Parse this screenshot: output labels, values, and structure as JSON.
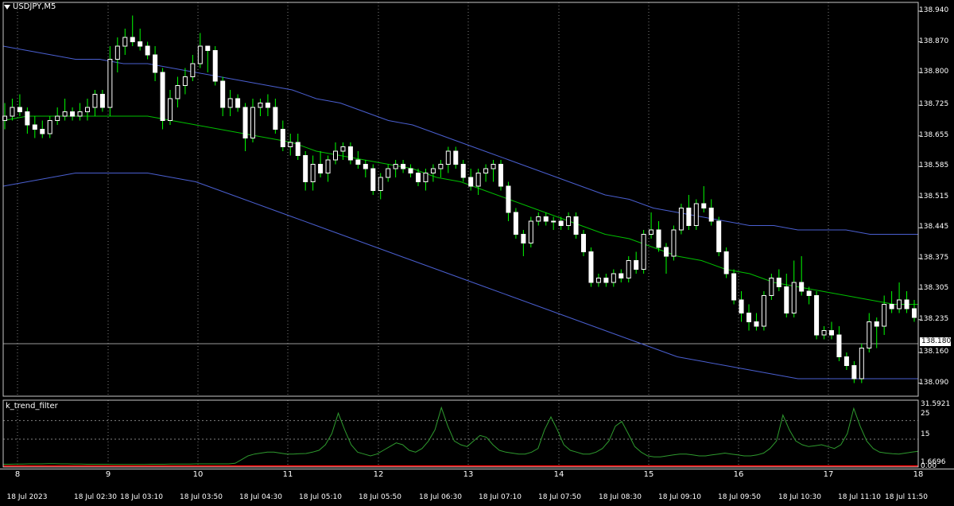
{
  "window": {
    "symbol_title": "USDJPY,M5",
    "indicator_title": "k_trend_filter",
    "current_price": "138.180"
  },
  "colors": {
    "background": "#000000",
    "grid": "#808080",
    "candle_up": "#ffffff",
    "candle_down": "#ffffff",
    "wick": "#00ff00",
    "ma_line": "#00c000",
    "band_line": "#4a5fd0",
    "indicator_line": "#2e9a2e",
    "indicator_zero": "#ff0000"
  },
  "price_axis": {
    "labels": [
      "138.940",
      "138.870",
      "138.800",
      "138.725",
      "138.655",
      "138.585",
      "138.515",
      "138.445",
      "138.375",
      "138.305",
      "138.235",
      "138.160",
      "138.090"
    ]
  },
  "sub_axis": {
    "labels": [
      "31.5921",
      "25",
      "15",
      "1.6696",
      "0.00"
    ]
  },
  "day_labels": [
    "8",
    "9",
    "10",
    "11",
    "12",
    "13",
    "14",
    "15",
    "16",
    "17",
    "18"
  ],
  "time_labels": [
    "18 Jul 2023",
    "18 Jul 02:30",
    "18 Jul 03:10",
    "18 Jul 03:50",
    "18 Jul 04:30",
    "18 Jul 05:10",
    "18 Jul 05:50",
    "18 Jul 06:30",
    "18 Jul 07:10",
    "18 Jul 07:50",
    "18 Jul 08:30",
    "18 Jul 09:10",
    "18 Jul 09:50",
    "18 Jul 10:30",
    "18 Jul 11:10",
    "18 Jul 11:50"
  ],
  "chart_data": {
    "type": "candlestick",
    "symbol": "USDJPY",
    "timeframe": "M5",
    "ylim": [
      138.06,
      138.96
    ],
    "candles": [
      {
        "o": 138.69,
        "h": 138.73,
        "l": 138.67,
        "c": 138.7
      },
      {
        "o": 138.7,
        "h": 138.74,
        "l": 138.69,
        "c": 138.72
      },
      {
        "o": 138.72,
        "h": 138.75,
        "l": 138.7,
        "c": 138.71
      },
      {
        "o": 138.71,
        "h": 138.72,
        "l": 138.66,
        "c": 138.68
      },
      {
        "o": 138.68,
        "h": 138.7,
        "l": 138.65,
        "c": 138.67
      },
      {
        "o": 138.67,
        "h": 138.69,
        "l": 138.65,
        "c": 138.66
      },
      {
        "o": 138.66,
        "h": 138.7,
        "l": 138.65,
        "c": 138.69
      },
      {
        "o": 138.69,
        "h": 138.72,
        "l": 138.68,
        "c": 138.7
      },
      {
        "o": 138.7,
        "h": 138.74,
        "l": 138.69,
        "c": 138.71
      },
      {
        "o": 138.71,
        "h": 138.72,
        "l": 138.69,
        "c": 138.7
      },
      {
        "o": 138.7,
        "h": 138.73,
        "l": 138.69,
        "c": 138.71
      },
      {
        "o": 138.71,
        "h": 138.74,
        "l": 138.69,
        "c": 138.72
      },
      {
        "o": 138.72,
        "h": 138.76,
        "l": 138.7,
        "c": 138.75
      },
      {
        "o": 138.75,
        "h": 138.76,
        "l": 138.71,
        "c": 138.72
      },
      {
        "o": 138.72,
        "h": 138.86,
        "l": 138.7,
        "c": 138.83
      },
      {
        "o": 138.83,
        "h": 138.88,
        "l": 138.8,
        "c": 138.86
      },
      {
        "o": 138.86,
        "h": 138.9,
        "l": 138.84,
        "c": 138.88
      },
      {
        "o": 138.88,
        "h": 138.93,
        "l": 138.86,
        "c": 138.87
      },
      {
        "o": 138.87,
        "h": 138.9,
        "l": 138.85,
        "c": 138.86
      },
      {
        "o": 138.86,
        "h": 138.87,
        "l": 138.83,
        "c": 138.84
      },
      {
        "o": 138.84,
        "h": 138.86,
        "l": 138.78,
        "c": 138.8
      },
      {
        "o": 138.8,
        "h": 138.81,
        "l": 138.67,
        "c": 138.69
      },
      {
        "o": 138.69,
        "h": 138.76,
        "l": 138.68,
        "c": 138.74
      },
      {
        "o": 138.74,
        "h": 138.79,
        "l": 138.72,
        "c": 138.77
      },
      {
        "o": 138.77,
        "h": 138.81,
        "l": 138.75,
        "c": 138.79
      },
      {
        "o": 138.79,
        "h": 138.84,
        "l": 138.78,
        "c": 138.82
      },
      {
        "o": 138.82,
        "h": 138.89,
        "l": 138.81,
        "c": 138.86
      },
      {
        "o": 138.86,
        "h": 138.86,
        "l": 138.8,
        "c": 138.85
      },
      {
        "o": 138.85,
        "h": 138.86,
        "l": 138.77,
        "c": 138.78
      },
      {
        "o": 138.78,
        "h": 138.79,
        "l": 138.7,
        "c": 138.72
      },
      {
        "o": 138.72,
        "h": 138.76,
        "l": 138.7,
        "c": 138.74
      },
      {
        "o": 138.74,
        "h": 138.75,
        "l": 138.71,
        "c": 138.72
      },
      {
        "o": 138.72,
        "h": 138.73,
        "l": 138.62,
        "c": 138.65
      },
      {
        "o": 138.65,
        "h": 138.74,
        "l": 138.64,
        "c": 138.72
      },
      {
        "o": 138.72,
        "h": 138.74,
        "l": 138.7,
        "c": 138.73
      },
      {
        "o": 138.73,
        "h": 138.75,
        "l": 138.7,
        "c": 138.72
      },
      {
        "o": 138.72,
        "h": 138.74,
        "l": 138.66,
        "c": 138.67
      },
      {
        "o": 138.67,
        "h": 138.69,
        "l": 138.62,
        "c": 138.63
      },
      {
        "o": 138.63,
        "h": 138.66,
        "l": 138.61,
        "c": 138.64
      },
      {
        "o": 138.64,
        "h": 138.66,
        "l": 138.6,
        "c": 138.61
      },
      {
        "o": 138.61,
        "h": 138.62,
        "l": 138.53,
        "c": 138.55
      },
      {
        "o": 138.55,
        "h": 138.61,
        "l": 138.53,
        "c": 138.59
      },
      {
        "o": 138.59,
        "h": 138.62,
        "l": 138.56,
        "c": 138.57
      },
      {
        "o": 138.57,
        "h": 138.61,
        "l": 138.55,
        "c": 138.6
      },
      {
        "o": 138.6,
        "h": 138.64,
        "l": 138.59,
        "c": 138.62
      },
      {
        "o": 138.62,
        "h": 138.64,
        "l": 138.6,
        "c": 138.63
      },
      {
        "o": 138.63,
        "h": 138.64,
        "l": 138.59,
        "c": 138.6
      },
      {
        "o": 138.6,
        "h": 138.62,
        "l": 138.58,
        "c": 138.59
      },
      {
        "o": 138.59,
        "h": 138.6,
        "l": 138.56,
        "c": 138.58
      },
      {
        "o": 138.58,
        "h": 138.59,
        "l": 138.52,
        "c": 138.53
      },
      {
        "o": 138.53,
        "h": 138.57,
        "l": 138.51,
        "c": 138.56
      },
      {
        "o": 138.56,
        "h": 138.59,
        "l": 138.55,
        "c": 138.58
      },
      {
        "o": 138.58,
        "h": 138.6,
        "l": 138.56,
        "c": 138.59
      },
      {
        "o": 138.59,
        "h": 138.6,
        "l": 138.57,
        "c": 138.58
      },
      {
        "o": 138.58,
        "h": 138.59,
        "l": 138.56,
        "c": 138.57
      },
      {
        "o": 138.57,
        "h": 138.58,
        "l": 138.54,
        "c": 138.55
      },
      {
        "o": 138.55,
        "h": 138.58,
        "l": 138.53,
        "c": 138.57
      },
      {
        "o": 138.57,
        "h": 138.59,
        "l": 138.55,
        "c": 138.58
      },
      {
        "o": 138.58,
        "h": 138.6,
        "l": 138.56,
        "c": 138.59
      },
      {
        "o": 138.59,
        "h": 138.63,
        "l": 138.57,
        "c": 138.62
      },
      {
        "o": 138.62,
        "h": 138.63,
        "l": 138.58,
        "c": 138.59
      },
      {
        "o": 138.59,
        "h": 138.6,
        "l": 138.55,
        "c": 138.56
      },
      {
        "o": 138.56,
        "h": 138.58,
        "l": 138.53,
        "c": 138.54
      },
      {
        "o": 138.54,
        "h": 138.58,
        "l": 138.52,
        "c": 138.57
      },
      {
        "o": 138.57,
        "h": 138.59,
        "l": 138.55,
        "c": 138.58
      },
      {
        "o": 138.58,
        "h": 138.6,
        "l": 138.55,
        "c": 138.59
      },
      {
        "o": 138.59,
        "h": 138.6,
        "l": 138.53,
        "c": 138.54
      },
      {
        "o": 138.54,
        "h": 138.55,
        "l": 138.46,
        "c": 138.48
      },
      {
        "o": 138.48,
        "h": 138.49,
        "l": 138.42,
        "c": 138.43
      },
      {
        "o": 138.43,
        "h": 138.44,
        "l": 138.38,
        "c": 138.41
      },
      {
        "o": 138.41,
        "h": 138.47,
        "l": 138.4,
        "c": 138.46
      },
      {
        "o": 138.46,
        "h": 138.48,
        "l": 138.45,
        "c": 138.47
      },
      {
        "o": 138.47,
        "h": 138.48,
        "l": 138.45,
        "c": 138.46
      },
      {
        "o": 138.46,
        "h": 138.47,
        "l": 138.44,
        "c": 138.46
      },
      {
        "o": 138.46,
        "h": 138.47,
        "l": 138.44,
        "c": 138.45
      },
      {
        "o": 138.45,
        "h": 138.48,
        "l": 138.44,
        "c": 138.47
      },
      {
        "o": 138.47,
        "h": 138.48,
        "l": 138.42,
        "c": 138.43
      },
      {
        "o": 138.43,
        "h": 138.44,
        "l": 138.38,
        "c": 138.39
      },
      {
        "o": 138.39,
        "h": 138.4,
        "l": 138.31,
        "c": 138.32
      },
      {
        "o": 138.32,
        "h": 138.34,
        "l": 138.31,
        "c": 138.33
      },
      {
        "o": 138.33,
        "h": 138.34,
        "l": 138.31,
        "c": 138.32
      },
      {
        "o": 138.32,
        "h": 138.35,
        "l": 138.31,
        "c": 138.34
      },
      {
        "o": 138.34,
        "h": 138.35,
        "l": 138.32,
        "c": 138.33
      },
      {
        "o": 138.33,
        "h": 138.38,
        "l": 138.32,
        "c": 138.37
      },
      {
        "o": 138.37,
        "h": 138.39,
        "l": 138.34,
        "c": 138.35
      },
      {
        "o": 138.35,
        "h": 138.44,
        "l": 138.34,
        "c": 138.43
      },
      {
        "o": 138.43,
        "h": 138.48,
        "l": 138.42,
        "c": 138.44
      },
      {
        "o": 138.44,
        "h": 138.46,
        "l": 138.39,
        "c": 138.4
      },
      {
        "o": 138.4,
        "h": 138.41,
        "l": 138.34,
        "c": 138.38
      },
      {
        "o": 138.38,
        "h": 138.45,
        "l": 138.37,
        "c": 138.44
      },
      {
        "o": 138.44,
        "h": 138.5,
        "l": 138.43,
        "c": 138.49
      },
      {
        "o": 138.49,
        "h": 138.52,
        "l": 138.44,
        "c": 138.45
      },
      {
        "o": 138.45,
        "h": 138.51,
        "l": 138.44,
        "c": 138.5
      },
      {
        "o": 138.5,
        "h": 138.54,
        "l": 138.48,
        "c": 138.49
      },
      {
        "o": 138.49,
        "h": 138.51,
        "l": 138.45,
        "c": 138.46
      },
      {
        "o": 138.46,
        "h": 138.47,
        "l": 138.38,
        "c": 138.39
      },
      {
        "o": 138.39,
        "h": 138.4,
        "l": 138.33,
        "c": 138.34
      },
      {
        "o": 138.34,
        "h": 138.35,
        "l": 138.27,
        "c": 138.28
      },
      {
        "o": 138.28,
        "h": 138.3,
        "l": 138.23,
        "c": 138.25
      },
      {
        "o": 138.25,
        "h": 138.27,
        "l": 138.21,
        "c": 138.23
      },
      {
        "o": 138.23,
        "h": 138.25,
        "l": 138.21,
        "c": 138.22
      },
      {
        "o": 138.22,
        "h": 138.3,
        "l": 138.21,
        "c": 138.29
      },
      {
        "o": 138.29,
        "h": 138.34,
        "l": 138.28,
        "c": 138.33
      },
      {
        "o": 138.33,
        "h": 138.35,
        "l": 138.3,
        "c": 138.31
      },
      {
        "o": 138.31,
        "h": 138.34,
        "l": 138.24,
        "c": 138.25
      },
      {
        "o": 138.25,
        "h": 138.37,
        "l": 138.24,
        "c": 138.32
      },
      {
        "o": 138.32,
        "h": 138.38,
        "l": 138.29,
        "c": 138.3
      },
      {
        "o": 138.3,
        "h": 138.31,
        "l": 138.27,
        "c": 138.29
      },
      {
        "o": 138.29,
        "h": 138.3,
        "l": 138.19,
        "c": 138.2
      },
      {
        "o": 138.2,
        "h": 138.22,
        "l": 138.19,
        "c": 138.21
      },
      {
        "o": 138.21,
        "h": 138.23,
        "l": 138.19,
        "c": 138.2
      },
      {
        "o": 138.2,
        "h": 138.22,
        "l": 138.14,
        "c": 138.15
      },
      {
        "o": 138.15,
        "h": 138.16,
        "l": 138.12,
        "c": 138.13
      },
      {
        "o": 138.13,
        "h": 138.14,
        "l": 138.09,
        "c": 138.1
      },
      {
        "o": 138.1,
        "h": 138.18,
        "l": 138.09,
        "c": 138.17
      },
      {
        "o": 138.17,
        "h": 138.25,
        "l": 138.16,
        "c": 138.23
      },
      {
        "o": 138.23,
        "h": 138.24,
        "l": 138.17,
        "c": 138.22
      },
      {
        "o": 138.22,
        "h": 138.29,
        "l": 138.2,
        "c": 138.27
      },
      {
        "o": 138.27,
        "h": 138.3,
        "l": 138.25,
        "c": 138.26
      },
      {
        "o": 138.26,
        "h": 138.32,
        "l": 138.25,
        "c": 138.28
      },
      {
        "o": 138.28,
        "h": 138.3,
        "l": 138.25,
        "c": 138.26
      },
      {
        "o": 138.26,
        "h": 138.28,
        "l": 138.23,
        "c": 138.24
      }
    ],
    "ma": [
      138.69,
      138.7,
      138.7,
      138.7,
      138.7,
      138.7,
      138.7,
      138.69,
      138.68,
      138.67,
      138.66,
      138.65,
      138.64,
      138.62,
      138.61,
      138.6,
      138.59,
      138.58,
      138.56,
      138.55,
      138.53,
      138.51,
      138.49,
      138.47,
      138.45,
      138.43,
      138.42,
      138.4,
      138.38,
      138.37,
      138.35,
      138.34,
      138.32,
      138.31,
      138.3,
      138.29,
      138.28,
      138.27,
      138.27
    ],
    "band_upper": [
      138.86,
      138.85,
      138.84,
      138.83,
      138.83,
      138.82,
      138.82,
      138.81,
      138.8,
      138.79,
      138.78,
      138.77,
      138.76,
      138.74,
      138.73,
      138.71,
      138.69,
      138.68,
      138.66,
      138.64,
      138.62,
      138.6,
      138.58,
      138.56,
      138.54,
      138.52,
      138.51,
      138.49,
      138.48,
      138.47,
      138.46,
      138.45,
      138.45,
      138.44,
      138.44,
      138.44,
      138.43,
      138.43,
      138.43
    ],
    "band_lower": [
      138.54,
      138.55,
      138.56,
      138.57,
      138.57,
      138.57,
      138.57,
      138.56,
      138.55,
      138.53,
      138.51,
      138.49,
      138.47,
      138.45,
      138.43,
      138.41,
      138.39,
      138.37,
      138.35,
      138.33,
      138.31,
      138.29,
      138.27,
      138.25,
      138.23,
      138.21,
      138.19,
      138.17,
      138.15,
      138.14,
      138.13,
      138.12,
      138.11,
      138.1,
      138.1,
      138.1,
      138.1,
      138.1,
      138.1
    ],
    "indicator": {
      "name": "k_trend_filter",
      "ylim": [
        0,
        36
      ],
      "values": [
        1.5,
        1.5,
        1.6,
        1.6,
        1.7,
        1.7,
        1.7,
        1.8,
        1.8,
        1.7,
        1.7,
        1.6,
        1.6,
        1.5,
        1.5,
        1.5,
        1.5,
        1.4,
        1.4,
        1.4,
        1.4,
        1.4,
        1.4,
        1.5,
        1.5,
        1.5,
        1.6,
        1.6,
        1.6,
        1.6,
        1.7,
        1.7,
        1.7,
        1.7,
        1.7,
        1.7,
        2.0,
        4.0,
        6.0,
        7.0,
        7.5,
        8.0,
        8.0,
        7.5,
        7.0,
        7.0,
        7.2,
        7.3,
        8.0,
        9.0,
        12.0,
        18.0,
        29.0,
        20.0,
        12.0,
        8.0,
        7.0,
        6.0,
        7.0,
        9.0,
        11.0,
        13.0,
        12.0,
        9.0,
        8.0,
        10.0,
        14.0,
        20.0,
        32.0,
        22.0,
        14.0,
        12.0,
        11.0,
        14.0,
        17.0,
        16.0,
        12.0,
        9.0,
        8.0,
        7.5,
        7.0,
        7.0,
        8.0,
        10.0,
        20.0,
        27.0,
        20.0,
        12.0,
        9.0,
        8.0,
        7.0,
        7.0,
        8.0,
        10.0,
        14.0,
        22.0,
        24.5,
        18.0,
        11.0,
        8.0,
        6.0,
        5.5,
        5.5,
        6.0,
        6.5,
        7.0,
        7.0,
        6.5,
        6.0,
        6.0,
        6.5,
        7.0,
        7.5,
        7.0,
        6.5,
        6.0,
        6.0,
        6.5,
        7.5,
        10.0,
        14.0,
        28.0,
        20.0,
        14.0,
        12.0,
        11.0,
        11.5,
        12.0,
        11.0,
        10.0,
        12.0,
        18.0,
        31.6,
        22.0,
        14.0,
        10.0,
        8.0,
        7.5,
        7.2,
        7.0,
        7.5,
        8.0,
        8.5
      ]
    }
  }
}
